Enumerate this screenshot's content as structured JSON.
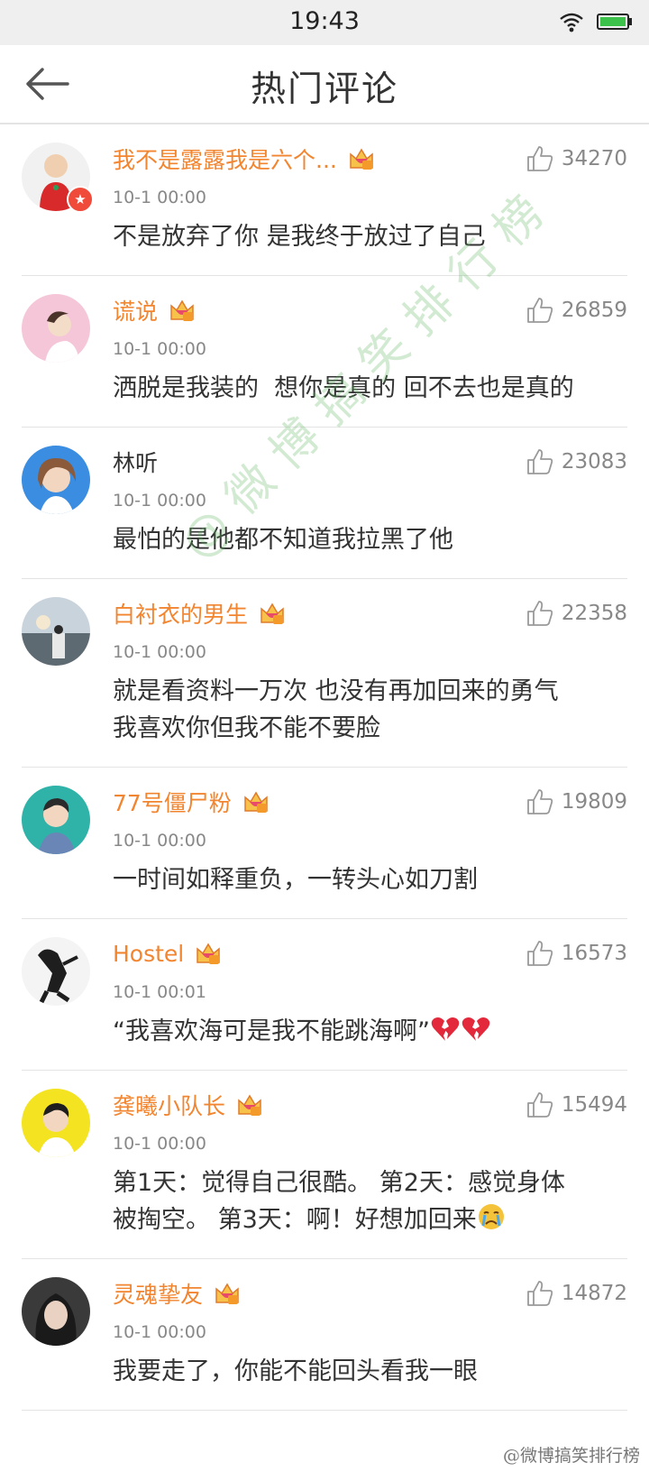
{
  "status_bar": {
    "time": "19:43"
  },
  "nav": {
    "title": "热门评论"
  },
  "comments": [
    {
      "username": "我不是露露我是六个...",
      "time": "10-1 00:00",
      "text": "不是放弃了你 是我终于放过了自己",
      "likes": "34270"
    },
    {
      "username": "谎说",
      "time": "10-1 00:00",
      "text": "洒脱是我装的  想你是真的 回不去也是真的",
      "likes": "26859"
    },
    {
      "username": "林听",
      "time": "10-1 00:00",
      "text": "最怕的是他都不知道我拉黑了他",
      "likes": "23083"
    },
    {
      "username": "白衬衣的男生",
      "time": "10-1 00:00",
      "text": "就是看资料一万次 也没有再加回来的勇气\n我喜欢你但我不能不要脸",
      "likes": "22358"
    },
    {
      "username": "77号僵尸粉",
      "time": "10-1 00:00",
      "text": "一时间如释重负，一转头心如刀割",
      "likes": "19809"
    },
    {
      "username": "Hostel",
      "time": "10-1 00:01",
      "text": "“我喜欢海可是我不能跳海啊”",
      "likes": "16573"
    },
    {
      "username": "龚曦小队长",
      "time": "10-1 00:00",
      "text": "第1天：觉得自己很酷。 第2天：感觉身体\n被掏空。 第3天：啊！好想加回来",
      "likes": "15494"
    },
    {
      "username": "灵魂挚友",
      "time": "10-1 00:00",
      "text": "我要走了，你能不能回头看我一眼",
      "likes": "14872"
    }
  ],
  "watermark": "@微博搞笑排行榜",
  "corner_watermark": "@微博搞笑排行榜",
  "colors": {
    "username": "#f28530",
    "badge": "#f04a3a",
    "vip": "#f3a33a"
  }
}
